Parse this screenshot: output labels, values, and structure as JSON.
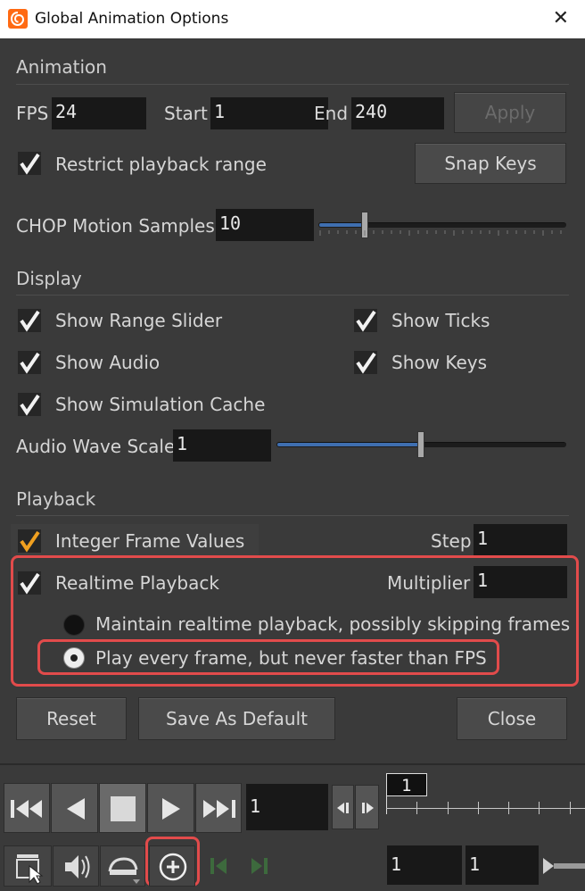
{
  "window": {
    "title": "Global Animation Options",
    "close_glyph": "✕"
  },
  "animation": {
    "section_title": "Animation",
    "fps_label": "FPS",
    "fps_value": "24",
    "start_label": "Start",
    "start_value": "1",
    "end_label": "End",
    "end_value": "240",
    "apply_label": "Apply",
    "restrict_label": "Restrict playback range",
    "restrict_checked": true,
    "snap_keys_label": "Snap Keys",
    "chop_label": "CHOP Motion Samples",
    "chop_value": "10"
  },
  "display": {
    "section_title": "Display",
    "show_range_slider": "Show Range Slider",
    "show_ticks": "Show Ticks",
    "show_audio": "Show Audio",
    "show_keys": "Show Keys",
    "show_sim_cache": "Show Simulation Cache",
    "audio_wave_label": "Audio Wave Scale",
    "audio_wave_value": "1"
  },
  "playback": {
    "section_title": "Playback",
    "integer_frames_label": "Integer Frame Values",
    "step_label": "Step",
    "step_value": "1",
    "realtime_label": "Realtime Playback",
    "multiplier_label": "Multiplier",
    "multiplier_value": "1",
    "option_skip": "Maintain realtime playback, possibly skipping frames",
    "option_every": "Play every frame, but never faster than FPS",
    "selected_option": "every"
  },
  "buttons": {
    "reset": "Reset",
    "save_default": "Save As Default",
    "close": "Close"
  },
  "playbar": {
    "frame_value": "1",
    "timeline_marker": "1",
    "range_start": "1",
    "range_end": "1"
  },
  "colors": {
    "accent_blue": "#3f6fb0",
    "highlight_red": "#e24b4b",
    "check_orange": "#f0a020"
  }
}
